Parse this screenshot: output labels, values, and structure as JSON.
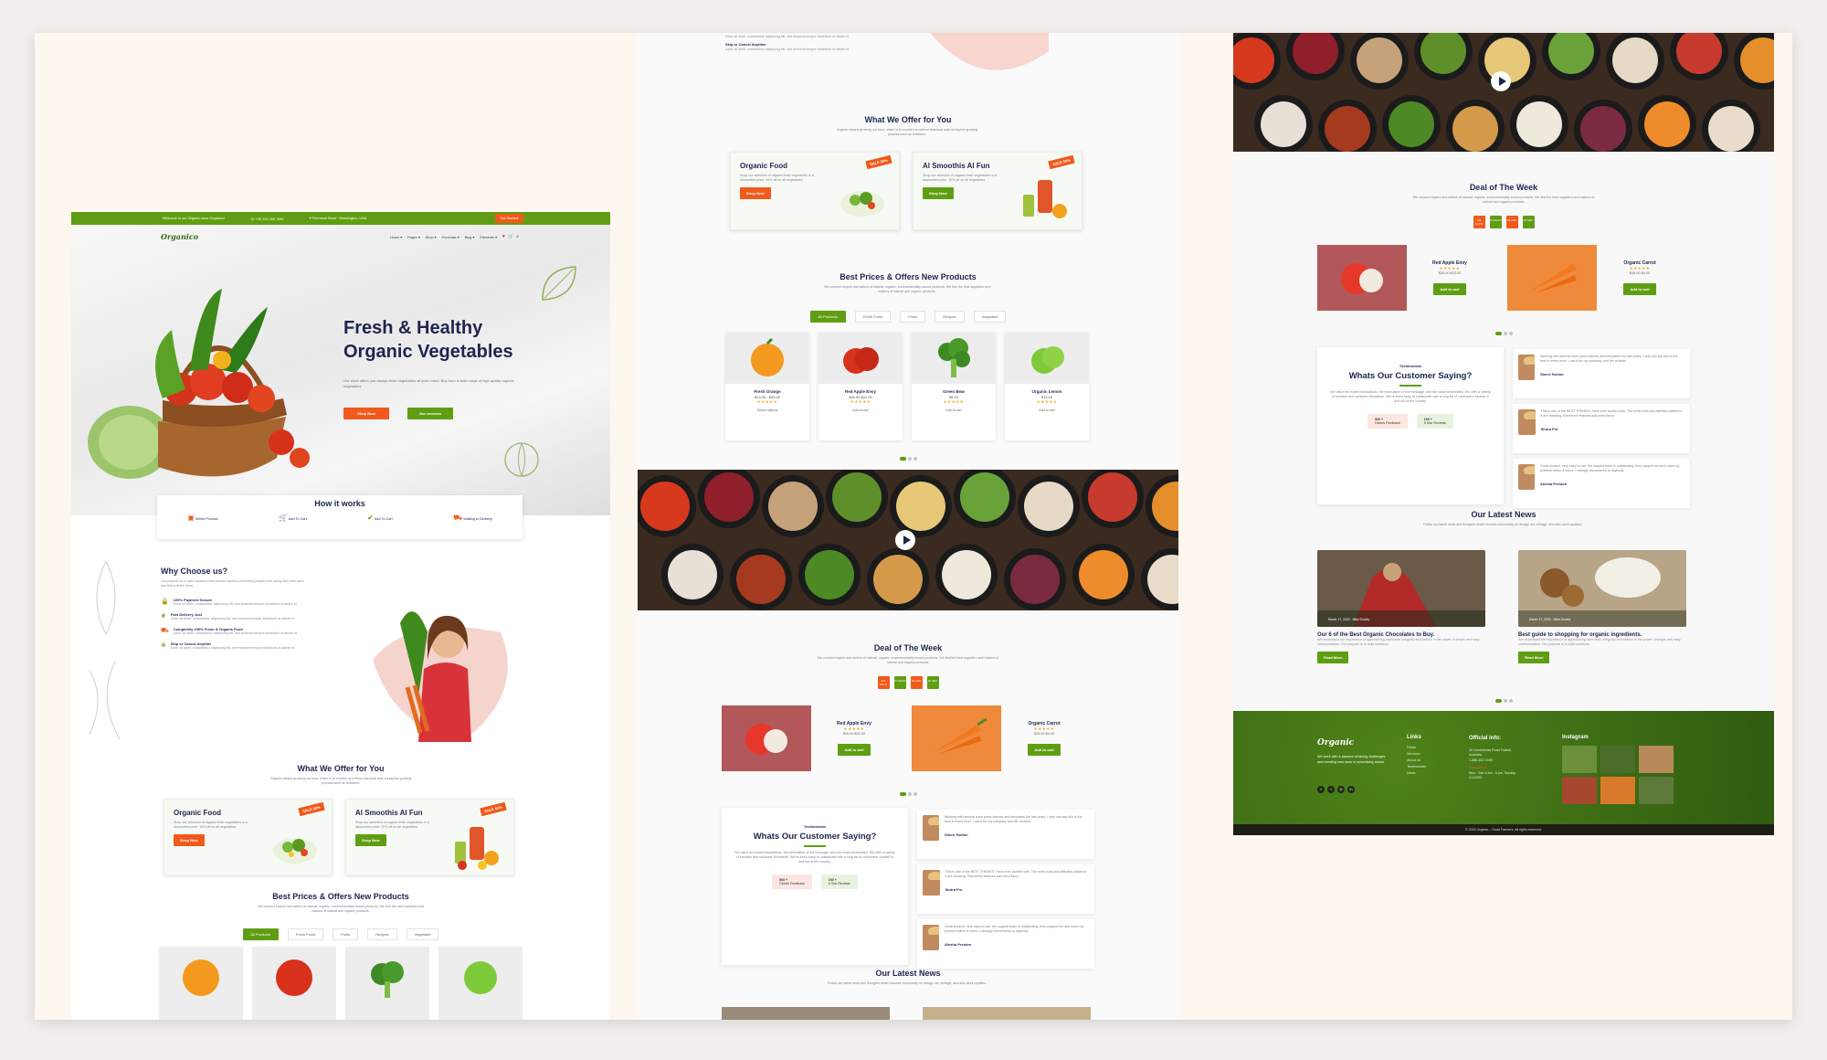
{
  "header": {
    "welcome": "Welcome to our Organic store Organico!",
    "phone": "+00 123 456 7890",
    "address": "Parmeset Road · Washington, USA",
    "cta": "Get Started",
    "logo": "Organico",
    "nav": [
      "Home ▾",
      "Pages ▾",
      "Shop ▾",
      "Purchase ▾",
      "Blog ▾",
      "Elements ▾"
    ]
  },
  "hero": {
    "title1": "Fresh & Healthy",
    "title2": "Organic Vegetables",
    "desc": "Our store offers you always fresh vegetables all year round. Buy from a wide range of high quality organic vegetables.",
    "shop_btn": "Shop Now",
    "services_btn": "Our services"
  },
  "how": {
    "title": "How it works",
    "steps": [
      "Select Product",
      "Add To Cart",
      "Add To Cart",
      "Waiting to Delivery"
    ]
  },
  "why": {
    "title": "Why Choose us?",
    "desc": "Our purpose is to build solutions that remove barriers preventing people from doing their best work, and this is at the heart.",
    "features": [
      {
        "title": "100% Payment Secure",
        "desc": "Dolor sit amet, consectetur adipiscing elit, sed eiusmod tempor incididunt ut labore et."
      },
      {
        "title": "Fast Delivery Just",
        "desc": "Dolor sit amet, consectetur adipiscing elit, sed eiusmod tempor incididunt ut labore et."
      },
      {
        "title": "Completely 100% Fresh & Organic Food",
        "desc": "Dolor sit amet, consectetur adipiscing elit, sed eiusmod tempor incididunt ut labore et."
      },
      {
        "title": "Skip or Cancel Anytime",
        "desc": "Dolor sit amet, consectetur adipiscing elit, sed eiusmod tempor incididunt ut labore et."
      }
    ]
  },
  "offer": {
    "title": "What We Offer for You",
    "desc": "Organic means growing our food, which is to nourish us without chemical aids during the growing process such as fertilizers.",
    "cards": [
      {
        "title": "Organic Food",
        "desc": "Shop our selection of organic fresh vegetables in a discounted price. 10% off on all vegetables.",
        "btn": "Shop Now",
        "badge": "SALE 50%"
      },
      {
        "title": "Al Smoothis Al Fun",
        "desc": "Shop our selection of organic fresh vegetables in a discounted price. 10% off on all vegetables.",
        "btn": "Shop Now",
        "badge": "SALE 50%"
      }
    ]
  },
  "products": {
    "title": "Best Prices & Offers New Products",
    "desc": "We connect buyers and sellers of natural, organic, environmentally sound products. We find the best suppliers and makers of natural and organic products.",
    "tabs": [
      "All Products",
      "Fresh Fruits",
      "Fruits",
      "Recipes",
      "Vegetable"
    ],
    "items": [
      {
        "name": "Fresh Orange",
        "price": "$13.00 - $65.00",
        "action": "Select options"
      },
      {
        "name": "Red Apple Envy",
        "price": "$26.00 $22.00",
        "action": "Add to cart"
      },
      {
        "name": "Green Bow",
        "price": "$6.00",
        "action": "Add to cart"
      },
      {
        "name": "Organic Lemon",
        "price": "$12.00",
        "action": "Add to cart"
      }
    ]
  },
  "deal": {
    "title": "Deal of The Week",
    "desc": "We connect buyers and sellers of natural, organic, environmentally sound products. We find the best suppliers and makers of natural and organic products.",
    "timer": [
      "121 DAYS",
      "23 HOUR",
      "01 MIN",
      "45 SEC"
    ],
    "items": [
      {
        "name": "Red Apple Envy",
        "price": "$26.00 $22.00",
        "btn": "Add to cart"
      },
      {
        "name": "Organic Carrot",
        "price": "$25.00 $4.00",
        "btn": "Add to cart"
      }
    ]
  },
  "testimonials": {
    "eyebrow": "Testimonials",
    "title": "Whats Our Customer Saying?",
    "desc": "We value the expert translations, the information of the message, and the smart fenestrates. We offer a variety of services and solutions Worldwide. We've been lucky to collaborate with a long list of customers, located in and out of the country.",
    "stat1_value": "500 +",
    "stat1_label": "Clients Feedback",
    "stat2_value": "150 +",
    "stat2_label": "5 Star Reviews",
    "items": [
      {
        "text": "Working with several word press themes and templates the last years, I only can say this is the best in every level. I use it for my company and the reviews.",
        "name": "Sherri Horton"
      },
      {
        "text": "This is one of the BEST THEMES I have ever worked with. The extra tools and attention added to it are amazing. Elementor features add extra flavor.",
        "name": "Sintra Fro"
      },
      {
        "text": "Great product, very easy to use, the support team is outstanding, they support me and solve my problem within 8 hours. I strongly recommend to anybody.",
        "name": "Alesha Preston"
      }
    ]
  },
  "news": {
    "title": "Our Latest News",
    "desc": "Follow our latest news and thoughts which focuses exclusively on design, art, vintage, and also work updates.",
    "items": [
      {
        "meta": "March 17, 2023 · Mike Dooley",
        "title": "Our 6 of the Best Organic Chocolates to Buy.",
        "desc": "We understand the importance of approaching each work integrally and believe in the power of simple and easy communication. Our purpose is to build solutions.",
        "btn": "Read More"
      },
      {
        "meta": "March 17, 2023 · Mike Dooley",
        "title": "Best guide to shopping for organic ingredients.",
        "desc": "We understand the importance of approaching each work integrally and believe in the power of simple and easy communication. Our purpose is to build solutions.",
        "btn": "Read More"
      }
    ]
  },
  "footer": {
    "logo": "Organic",
    "tagline": "We work with a passion of taking challenges and creating new ones in advertising sector.",
    "links_title": "Links",
    "links": [
      "Home",
      "Services",
      "About us",
      "Testimonials",
      "News"
    ],
    "info_title": "Official info:",
    "info": [
      "30 Commercial Road Fratton, Australia",
      "1-888-452-1505"
    ],
    "hours_label": "Open Hours:",
    "hours": "Mon - Sat: 8 am - 5 pm, Sunday: CLOSED",
    "insta_title": "Instagram",
    "copyright": "© 2023 Organic – Good Farmers. All rights reserved."
  },
  "colors": {
    "green": "#5f9e12",
    "orange": "#f05a1c",
    "navy": "#1f2450",
    "footer": "#3e6b14"
  }
}
